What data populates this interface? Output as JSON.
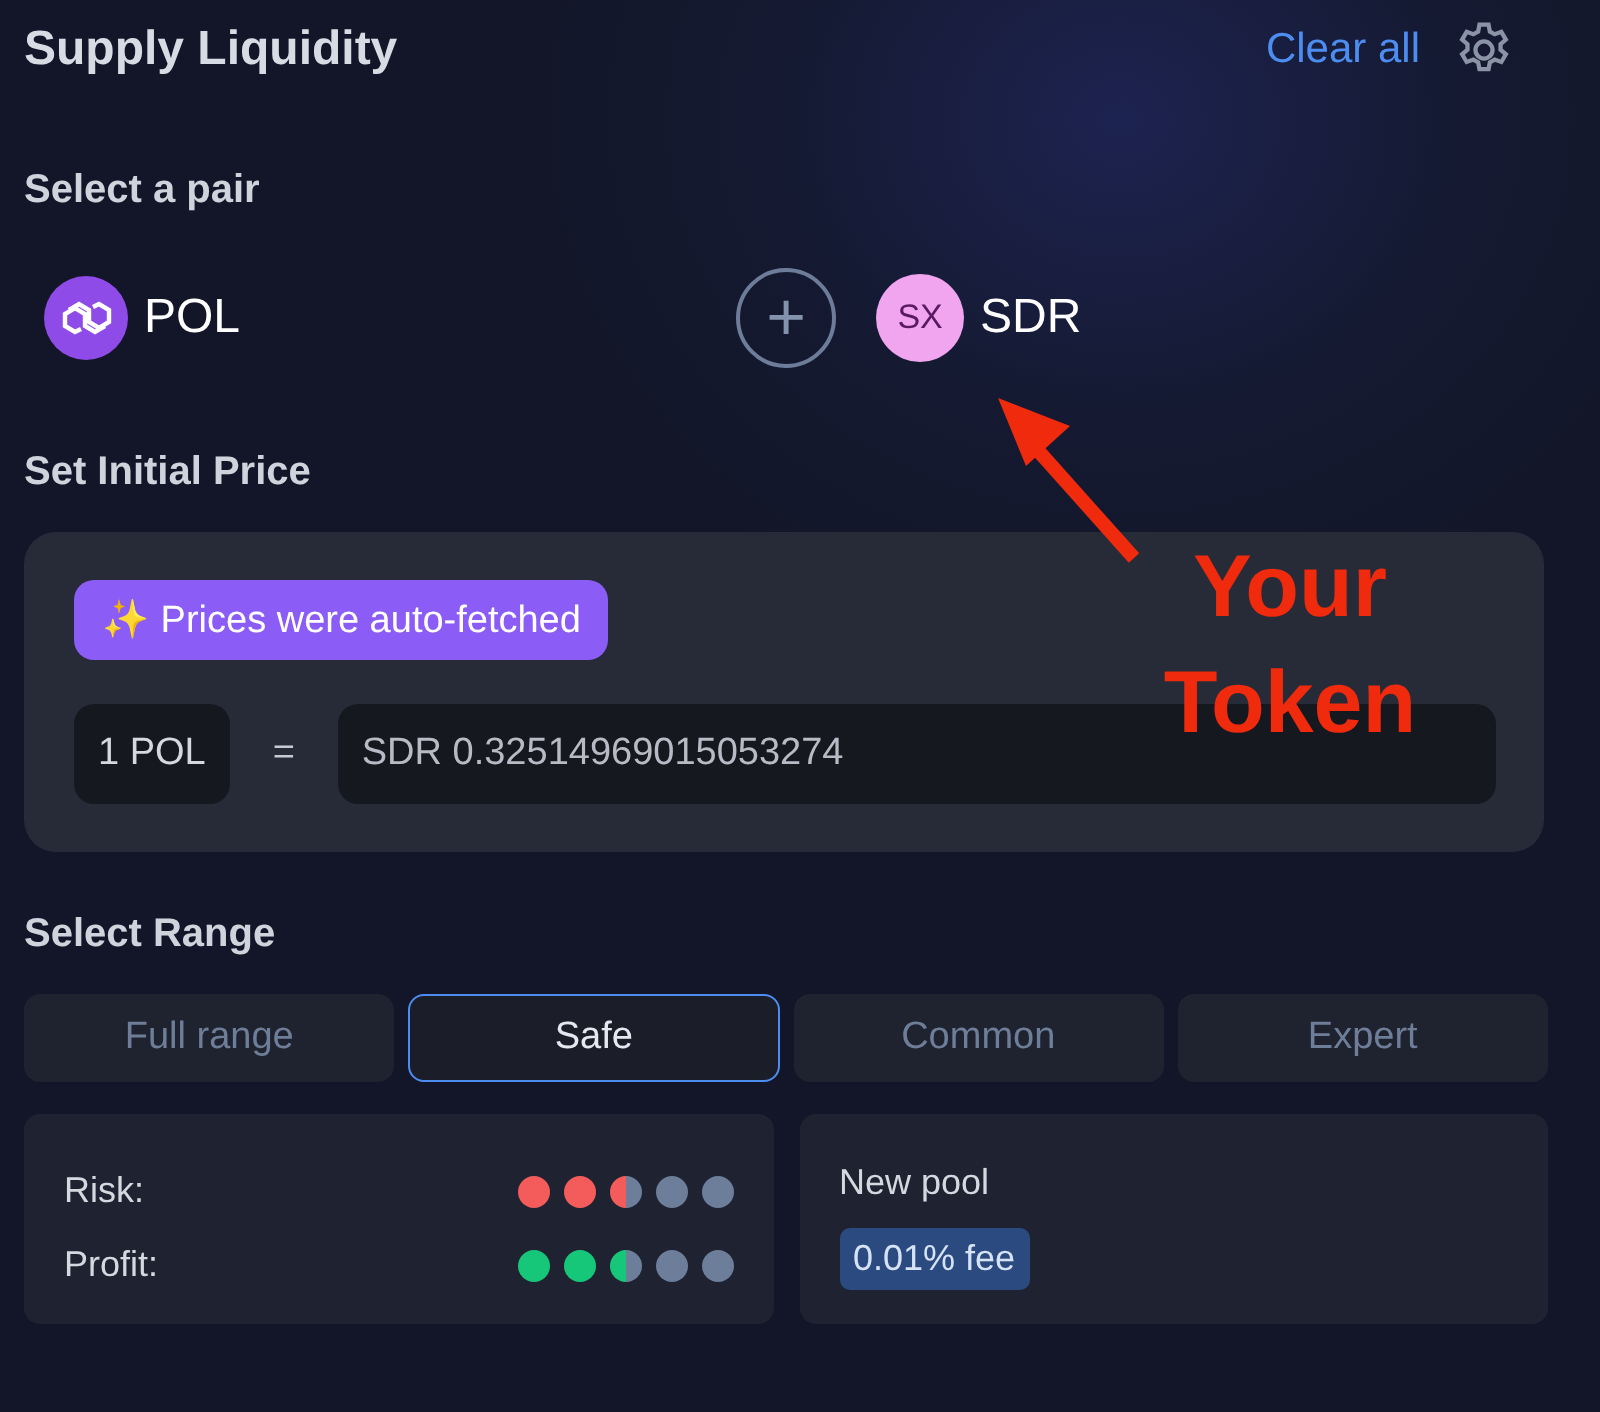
{
  "header": {
    "title": "Supply Liquidity",
    "clear_link": "Clear all"
  },
  "pair": {
    "heading": "Select a pair",
    "token_a": {
      "symbol": "POL"
    },
    "plus": "+",
    "token_b": {
      "badge": "SX",
      "symbol": "SDR"
    }
  },
  "annotation": {
    "text": "Your Token"
  },
  "price": {
    "heading": "Set Initial Price",
    "notice": "✨ Prices were auto-fetched",
    "base": "1 POL",
    "equals": "=",
    "value": "SDR 0.32514969015053274"
  },
  "range": {
    "heading": "Select Range",
    "tabs": [
      {
        "label": "Full range",
        "selected": false
      },
      {
        "label": "Safe",
        "selected": true
      },
      {
        "label": "Common",
        "selected": false
      },
      {
        "label": "Expert",
        "selected": false
      }
    ]
  },
  "meters": [
    {
      "label": "Risk:",
      "stars": 2.5,
      "color": "#f45b5b"
    },
    {
      "label": "Profit:",
      "stars": 2.5,
      "color": "#16c77a"
    }
  ],
  "pool": {
    "title": "New pool",
    "fee": "0.01% fee"
  }
}
